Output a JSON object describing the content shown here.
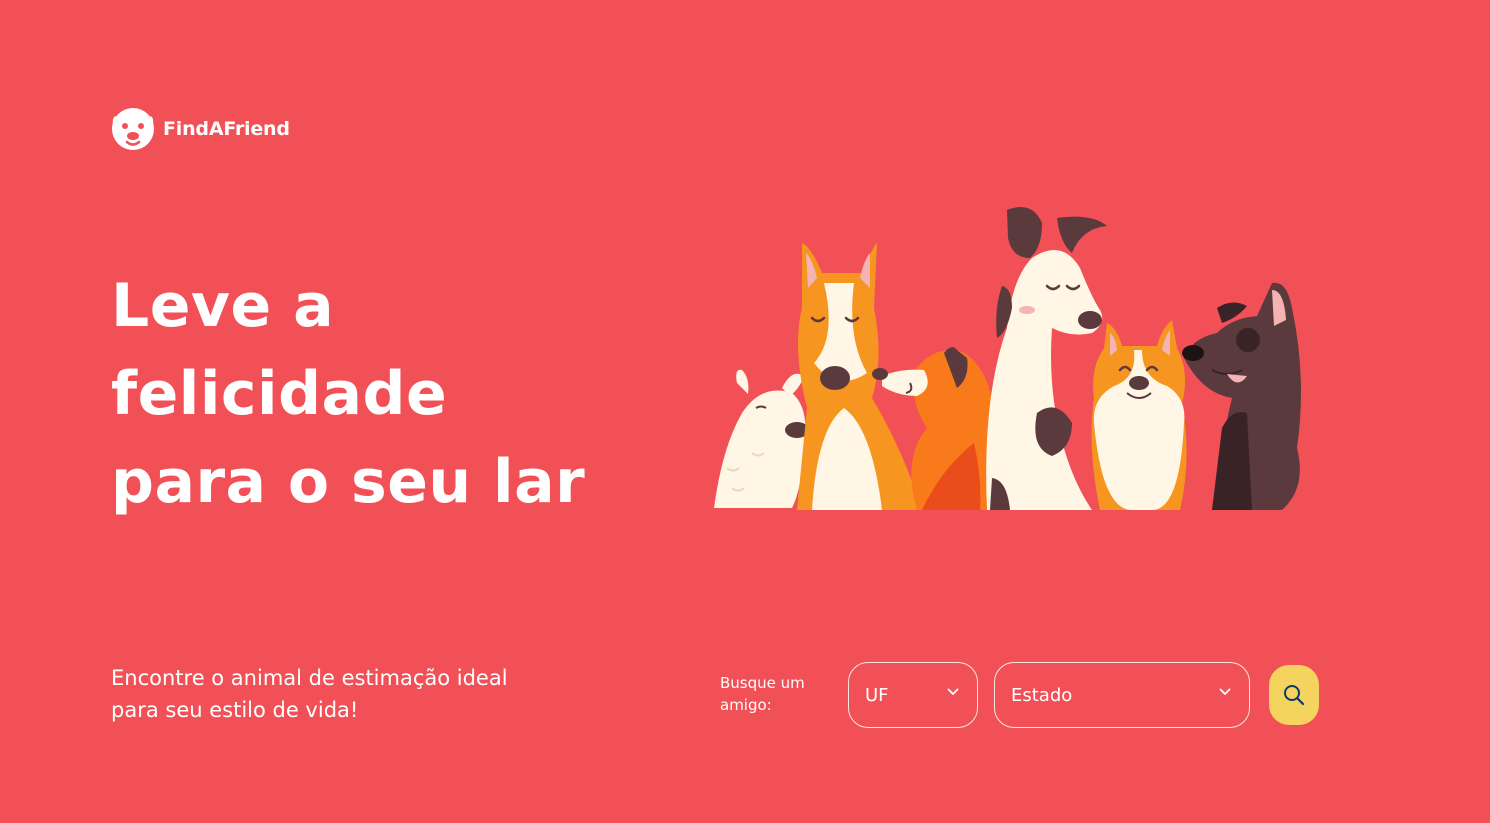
{
  "brand": {
    "name": "FindAFriend",
    "logo_icon": "dog-face-icon"
  },
  "hero": {
    "headline_lines": [
      "Leve a",
      "felicidade",
      "para o seu lar"
    ],
    "illustration": "group-of-dogs-illustration"
  },
  "subtitle": {
    "lines": [
      "Encontre o animal de estimação ideal",
      "para seu estilo de vida!"
    ]
  },
  "search": {
    "label_lines": [
      "Busque um",
      "amigo:"
    ],
    "uf_select": {
      "value": "UF",
      "icon": "chevron-down-icon"
    },
    "state_select": {
      "value": "Estado",
      "icon": "chevron-down-icon"
    },
    "button_icon": "search-icon"
  },
  "colors": {
    "background": "#F15156",
    "text": "#FFFFFF",
    "button": "#F4D35E",
    "button_icon": "#0D3B66"
  }
}
